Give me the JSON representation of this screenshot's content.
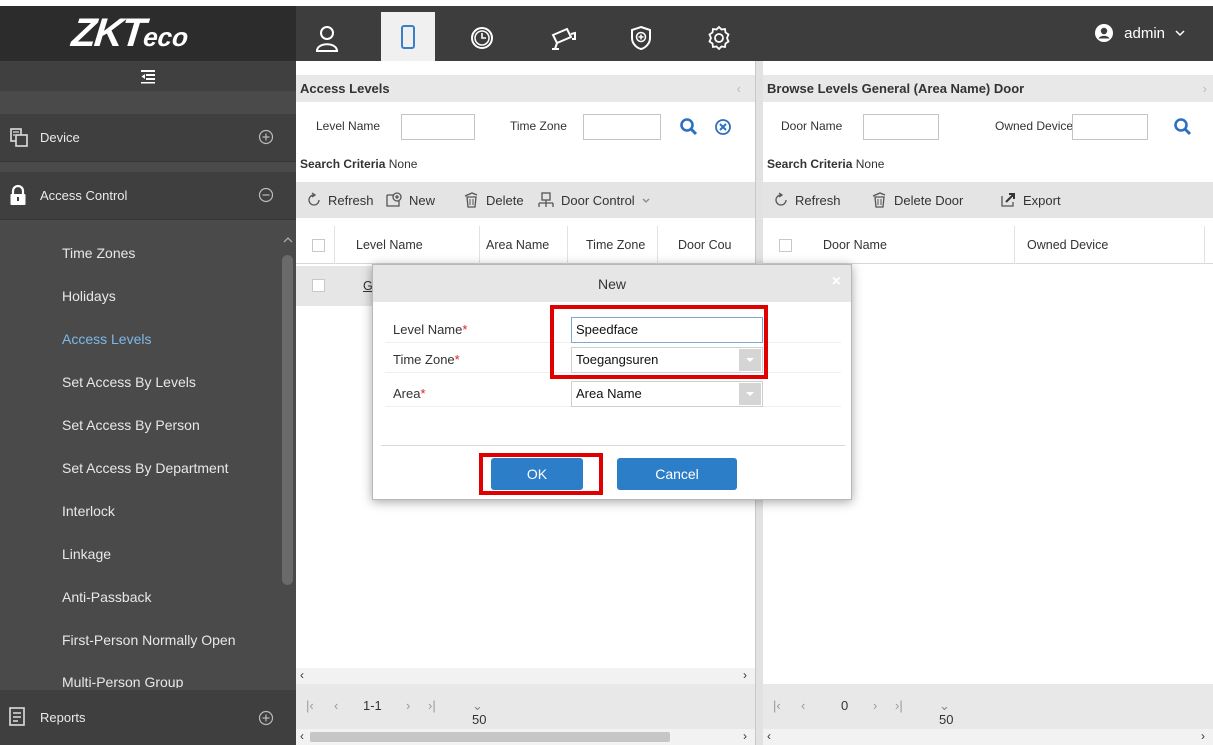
{
  "app": {
    "brand": "ZKT",
    "brand_suffix": "eco",
    "user": "admin"
  },
  "top_nav": [
    {
      "icon": "person-icon"
    },
    {
      "icon": "door-icon",
      "active": true
    },
    {
      "icon": "clock-icon"
    },
    {
      "icon": "camera-icon"
    },
    {
      "icon": "shield-plus-icon"
    },
    {
      "icon": "gear-icon"
    }
  ],
  "sidebar": {
    "sections": {
      "device": "Device",
      "access_control": "Access Control",
      "reports": "Reports"
    },
    "items": [
      {
        "label": "Time Zones"
      },
      {
        "label": "Holidays"
      },
      {
        "label": "Access Levels",
        "active": true
      },
      {
        "label": "Set Access By Levels"
      },
      {
        "label": "Set Access By Person"
      },
      {
        "label": "Set Access By Department"
      },
      {
        "label": "Interlock"
      },
      {
        "label": "Linkage"
      },
      {
        "label": "Anti-Passback"
      },
      {
        "label": "First-Person Normally Open"
      },
      {
        "label": "Multi-Person Group"
      }
    ]
  },
  "left_panel": {
    "title": "Access Levels",
    "search": {
      "level_name_label": "Level Name",
      "time_zone_label": "Time Zone",
      "criteria_label": "Search Criteria",
      "criteria_value": "None"
    },
    "toolbar": {
      "refresh": "Refresh",
      "new": "New",
      "delete": "Delete",
      "door_control": "Door Control"
    },
    "columns": [
      "Level Name",
      "Area Name",
      "Time Zone",
      "Door Cou"
    ],
    "rows": [
      {
        "level_name": "Ge"
      }
    ],
    "pager": {
      "range": "1-1",
      "rows_per_page": "50 rows per page"
    }
  },
  "right_panel": {
    "title": "Browse Levels General (Area Name) Door",
    "search": {
      "door_name_label": "Door Name",
      "owned_device_label": "Owned Device",
      "criteria_label": "Search Criteria",
      "criteria_value": "None"
    },
    "toolbar": {
      "refresh": "Refresh",
      "delete_door": "Delete Door",
      "export": "Export"
    },
    "columns": [
      "Door Name",
      "Owned Device"
    ],
    "pager": {
      "range": "0",
      "rows_per_page": "50 rows per page"
    }
  },
  "dialog": {
    "title": "New",
    "close": "×",
    "fields": {
      "level_name": {
        "label": "Level Name",
        "value": "Speedface"
      },
      "time_zone": {
        "label": "Time Zone",
        "value": "Toegangsuren"
      },
      "area": {
        "label": "Area",
        "value": "Area Name"
      }
    },
    "required_mark": "*",
    "ok": "OK",
    "cancel": "Cancel"
  },
  "colors": {
    "topbar": "#3d3d3d",
    "sidebar": "#4a4a4a",
    "accent_blue": "#2d7ec9",
    "active_link": "#7db9e8",
    "highlight_red": "#e00000",
    "required_red": "#e02020"
  }
}
